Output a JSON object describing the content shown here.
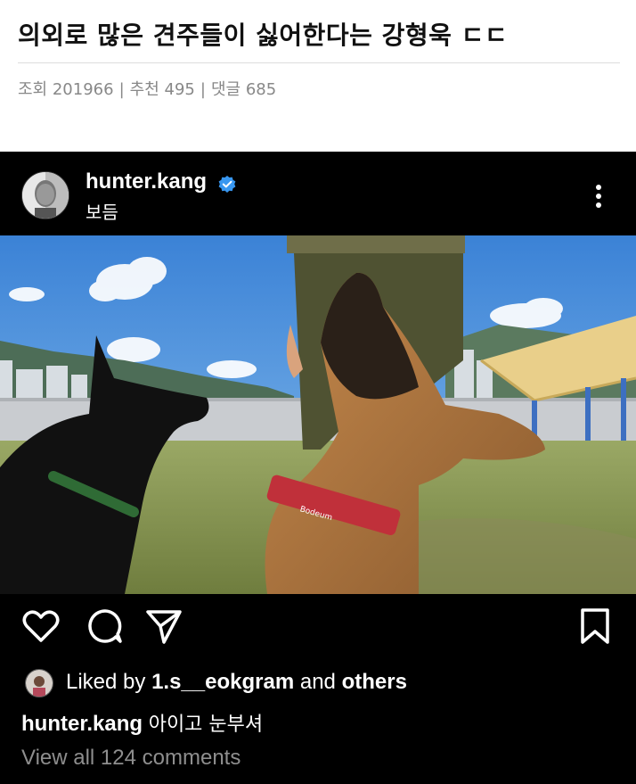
{
  "article": {
    "title": "의외로 많은 견주들이 싫어한다는 강형욱 ㄷㄷ",
    "views_label": "조회",
    "views": "201966",
    "recommend_label": "추천",
    "recommend": "495",
    "comments_label": "댓글",
    "comments": "685",
    "separator": "|"
  },
  "post": {
    "username": "hunter.kang",
    "location": "보듬",
    "liked_by_prefix": "Liked by",
    "liked_by_user": "1.s__eokgram",
    "liked_by_and": "and",
    "liked_by_others": "others",
    "caption_user": "hunter.kang",
    "caption_text": "아이고 눈부셔",
    "view_comments": "View all 124 comments",
    "collar_brand": "Bodeum"
  },
  "icons": {
    "verified": "verified-badge-icon",
    "more": "more-vertical-icon",
    "like": "heart-icon",
    "comment": "comment-icon",
    "share": "send-icon",
    "save": "bookmark-icon"
  },
  "colors": {
    "verified_blue": "#3897f0",
    "post_bg": "#000000",
    "muted_text": "#8e8e8e"
  }
}
